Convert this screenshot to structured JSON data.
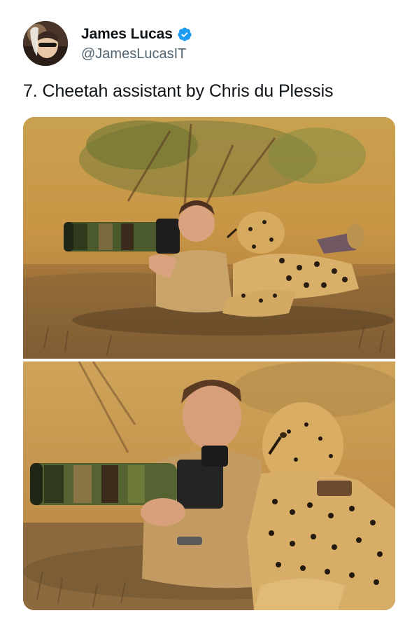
{
  "author": {
    "display_name": "James Lucas",
    "handle": "@JamesLucasIT",
    "verified": true,
    "verified_icon": "verified-badge-icon",
    "verified_color": "#1d9bf0"
  },
  "tweet": {
    "text": "7. Cheetah assistant by Chris du Plessis"
  },
  "media": {
    "photo_count": 2,
    "photos": [
      {
        "name": "photographer with camouflage telephoto lens lying next to cheetah (wide shot)"
      },
      {
        "name": "photographer with camouflage telephoto lens lying next to cheetah (close-up)"
      }
    ]
  },
  "colors": {
    "text_primary": "#0f1419",
    "text_secondary": "#536471",
    "background": "#ffffff"
  }
}
